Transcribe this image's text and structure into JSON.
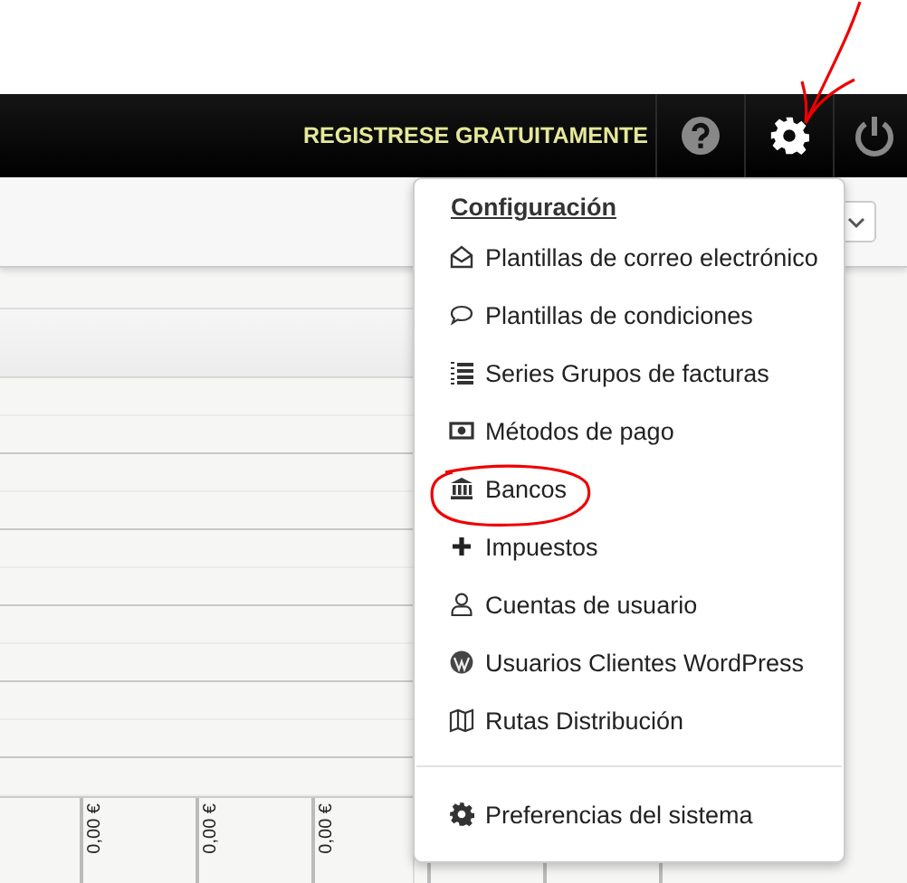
{
  "header": {
    "register_link": "REGISTRESE GRATUITAMENTE"
  },
  "menu": {
    "title": "Configuración",
    "items": [
      {
        "label": "Plantillas de correo electrónico",
        "kind": "envelope"
      },
      {
        "label": "Plantillas de condiciones",
        "kind": "comment"
      },
      {
        "label": "Series Grupos de facturas",
        "kind": "list"
      },
      {
        "label": "Métodos de pago",
        "kind": "money"
      },
      {
        "label": "Bancos",
        "kind": "bank"
      },
      {
        "label": "Impuestos",
        "kind": "plus"
      },
      {
        "label": "Cuentas de usuario",
        "kind": "user"
      },
      {
        "label": "Usuarios Clientes WordPress",
        "kind": "wordpress"
      },
      {
        "label": "Rutas Distribución",
        "kind": "map"
      }
    ],
    "footer_item": {
      "label": "Preferencias del sistema",
      "kind": "gear"
    }
  },
  "grid": {
    "cells": [
      "0,00 €",
      "0,00 €",
      "0,00 €"
    ]
  }
}
